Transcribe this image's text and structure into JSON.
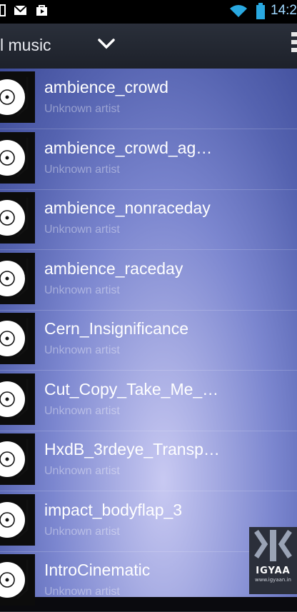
{
  "status_bar": {
    "time": "14:2",
    "icons": [
      "tablet-icon",
      "mail-icon",
      "shopping-bag-icon",
      "wifi-icon",
      "battery-icon"
    ]
  },
  "action_bar": {
    "title": "l music",
    "dropdown_icon": "chevron-down-icon",
    "menu_icon": "overflow-menu-icon"
  },
  "tracks": [
    {
      "title": "ambience_crowd",
      "artist": "Unknown artist"
    },
    {
      "title": "ambience_crowd_ag…",
      "artist": "Unknown artist"
    },
    {
      "title": "ambience_nonraceday",
      "artist": "Unknown artist"
    },
    {
      "title": "ambience_raceday",
      "artist": "Unknown artist"
    },
    {
      "title": "Cern_Insignificance",
      "artist": "Unknown artist"
    },
    {
      "title": "Cut_Copy_Take_Me_…",
      "artist": "Unknown artist"
    },
    {
      "title": "HxdB_3rdeye_Transp…",
      "artist": "Unknown artist"
    },
    {
      "title": "impact_bodyflap_3",
      "artist": "Unknown artist"
    },
    {
      "title": "IntroCinematic",
      "artist": "Unknown artist"
    }
  ],
  "watermark": {
    "brand": "IGYAA",
    "url": "www.igyaan.in"
  }
}
